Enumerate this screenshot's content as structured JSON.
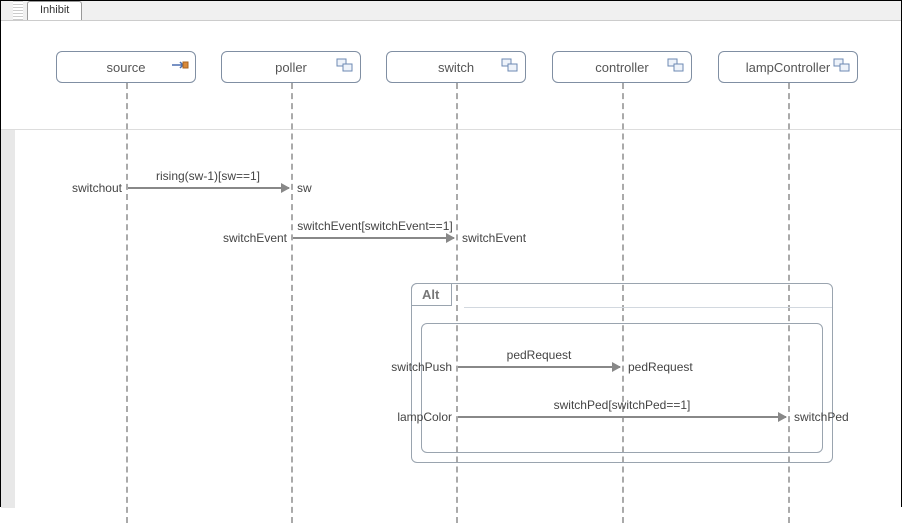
{
  "tab": {
    "label": "Inhibit"
  },
  "lifelines": [
    {
      "id": "source",
      "label": "source",
      "iconType": "source"
    },
    {
      "id": "poller",
      "label": "poller",
      "iconType": "composite"
    },
    {
      "id": "switch",
      "label": "switch",
      "iconType": "composite"
    },
    {
      "id": "controller",
      "label": "controller",
      "iconType": "composite"
    },
    {
      "id": "lampController",
      "label": "lampController",
      "iconType": "composite"
    }
  ],
  "messages": {
    "m0": {
      "sourceLabel": "switchout",
      "label": "rising(sw-1)[sw==1]",
      "targetLabel": "sw"
    },
    "m1": {
      "sourceLabel": "switchEvent",
      "label": "switchEvent[switchEvent==1]",
      "targetLabel": "switchEvent"
    },
    "m2": {
      "sourceLabel": "switchPush",
      "label": "pedRequest",
      "targetLabel": "pedRequest"
    },
    "m3": {
      "sourceLabel": "lampColor",
      "label": "switchPed[switchPed==1]",
      "targetLabel": "switchPed"
    }
  },
  "fragment": {
    "operator": "Alt"
  }
}
